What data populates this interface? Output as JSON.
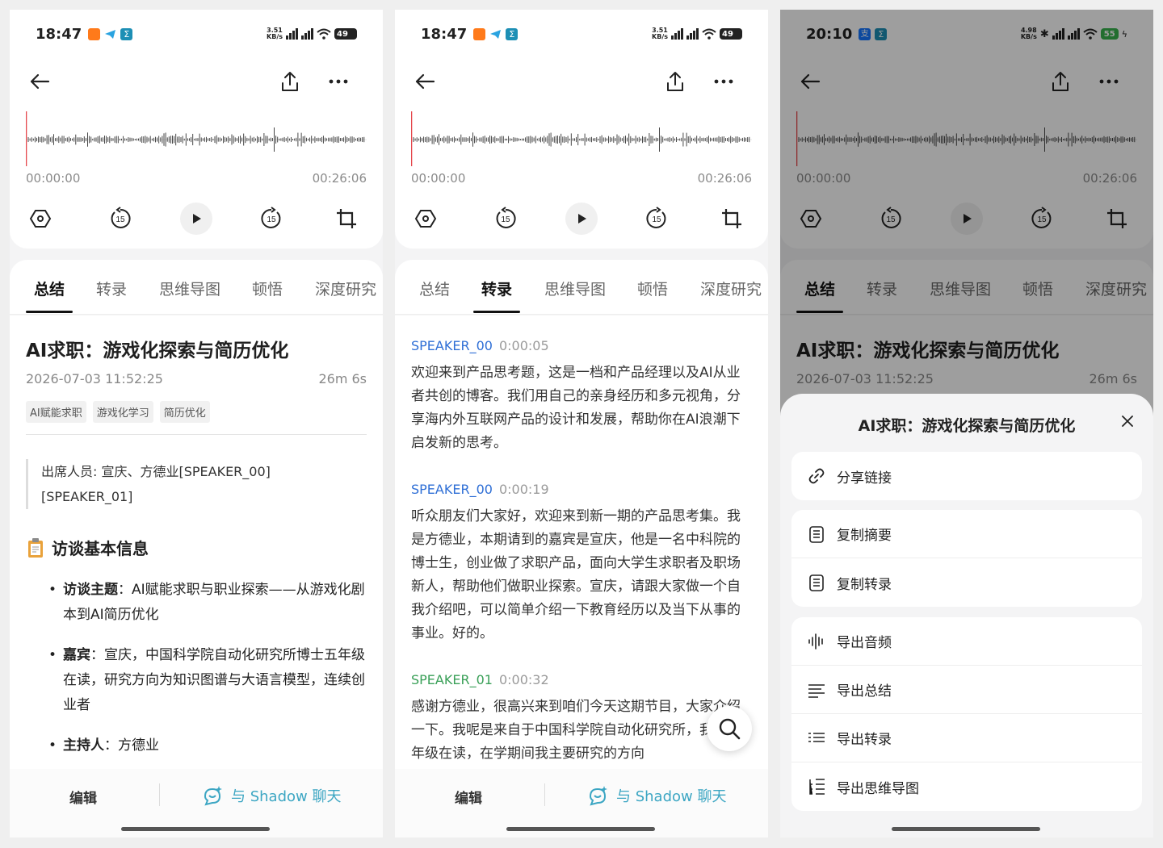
{
  "phones": [
    {
      "status": {
        "time": "18:47",
        "speed": "3.51\nKB/s",
        "battery": "49"
      },
      "player": {
        "start": "00:00:00",
        "end": "00:26:06",
        "rewind": "15",
        "forward": "15"
      },
      "tabs": [
        "总结",
        "转录",
        "思维导图",
        "顿悟",
        "深度研究"
      ],
      "active_tab": 0,
      "summary": {
        "title": "AI求职：游戏化探索与简历优化",
        "datetime": "2026-07-03 11:52:25",
        "duration": "26m 6s",
        "tags": [
          "AI赋能求职",
          "游戏化学习",
          "简历优化"
        ],
        "attendees": "出席人员: 宣庆、方德业[SPEAKER_00] [SPEAKER_01]",
        "section_title": "访谈基本信息",
        "bullets": [
          {
            "label": "访谈主题",
            "text": "：AI赋能求职与职业探索——从游戏化剧本到AI简历优化"
          },
          {
            "label": "嘉宾",
            "text": "：宣庆，中国科学院自动化研究所博士五年级在读，研究方向为知识图谱与大语言模型，连续创业者"
          },
          {
            "label": "主持人",
            "text": "：方德业"
          }
        ]
      },
      "bottom": {
        "edit": "编辑",
        "chat": "与 Shadow 聊天"
      }
    },
    {
      "status": {
        "time": "18:47",
        "speed": "3.51\nKB/s",
        "battery": "49"
      },
      "player": {
        "start": "00:00:00",
        "end": "00:26:06",
        "rewind": "15",
        "forward": "15"
      },
      "tabs": [
        "总结",
        "转录",
        "思维导图",
        "顿悟",
        "深度研究"
      ],
      "active_tab": 1,
      "transcript": [
        {
          "speaker": "SPEAKER_00",
          "time": "0:00:05",
          "text": "欢迎来到产品思考题，这是一档和产品经理以及AI从业者共创的博客。我们用自己的亲身经历和多元视角，分享海内外互联网产品的设计和发展，帮助你在AI浪潮下启发新的思考。"
        },
        {
          "speaker": "SPEAKER_00",
          "time": "0:00:19",
          "text": "听众朋友们大家好，欢迎来到新一期的产品思考集。我是方德业，本期请到的嘉宾是宣庆，他是一名中科院的博士生，创业做了求职产品，面向大学生求职者及职场新人，帮助他们做职业探索。宣庆，请跟大家做一个自我介绍吧，可以简单介绍一下教育经历以及当下从事的事业。好的。"
        },
        {
          "speaker": "SPEAKER_01",
          "time": "0:00:32",
          "text": "感谢方德业，很高兴来到咱们今天这期节目，大家介绍一下。我呢是来自于中国科学院自动化研究所，我是五年级在读，在学期间我主要研究的方向"
        }
      ],
      "bottom": {
        "edit": "编辑",
        "chat": "与 Shadow 聊天"
      }
    },
    {
      "status": {
        "time": "20:10",
        "speed": "4.98\nKB/s",
        "battery": "55"
      },
      "player": {
        "start": "00:00:00",
        "end": "00:26:06",
        "rewind": "15",
        "forward": "15"
      },
      "tabs": [
        "总结",
        "转录",
        "思维导图",
        "顿悟",
        "深度研究"
      ],
      "active_tab": 0,
      "summary": {
        "title": "AI求职：游戏化探索与简历优化",
        "datetime": "2026-07-03 11:52:25",
        "duration": "26m 6s"
      },
      "sheet": {
        "title": "AI求职：游戏化探索与简历优化",
        "groups": [
          [
            {
              "icon": "link-icon",
              "label": "分享链接"
            }
          ],
          [
            {
              "icon": "document-icon",
              "label": "复制摘要"
            },
            {
              "icon": "document-icon",
              "label": "复制转录"
            }
          ],
          [
            {
              "icon": "audio-wave-icon",
              "label": "导出音频"
            },
            {
              "icon": "lines-icon",
              "label": "导出总结"
            },
            {
              "icon": "list-icon",
              "label": "导出转录"
            },
            {
              "icon": "mindmap-icon",
              "label": "导出思维导图"
            }
          ]
        ]
      }
    }
  ],
  "colors": {
    "speaker_00": "#2f6fd6",
    "speaker_01": "#3aa058",
    "accent": "#3ca6c3",
    "playhead": "#e5484d"
  }
}
